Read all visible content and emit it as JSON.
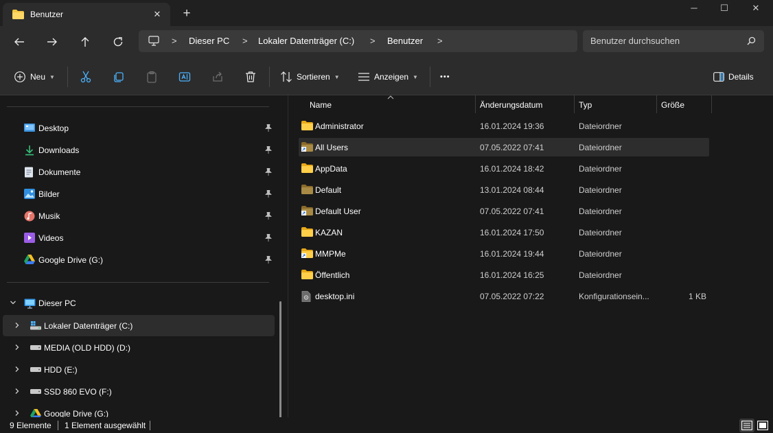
{
  "window": {
    "tab_title": "Benutzer",
    "tab_icon": "folder-icon",
    "close_tab_symbol": "✕",
    "new_tab_symbol": "+",
    "controls": {
      "minimize": "─",
      "maximize": "☐",
      "close": "✕"
    }
  },
  "nav": {
    "back": "arrow-left-icon",
    "forward": "arrow-right-icon",
    "up": "arrow-up-icon",
    "refresh": "refresh-icon"
  },
  "address": {
    "separator": ">",
    "crumbs": [
      "Dieser PC",
      "Lokaler Datenträger (C:)",
      "Benutzer"
    ]
  },
  "search": {
    "placeholder": "Benutzer durchsuchen"
  },
  "toolbar": {
    "new_label": "Neu",
    "sort_label": "Sortieren",
    "view_label": "Anzeigen",
    "more_label": "•••",
    "details_label": "Details"
  },
  "sidebar": {
    "quick_access": [
      {
        "label": "Desktop",
        "icon": "desktop-icon"
      },
      {
        "label": "Downloads",
        "icon": "download-icon"
      },
      {
        "label": "Dokumente",
        "icon": "document-icon"
      },
      {
        "label": "Bilder",
        "icon": "pictures-icon"
      },
      {
        "label": "Musik",
        "icon": "music-icon"
      },
      {
        "label": "Videos",
        "icon": "video-icon"
      },
      {
        "label": "Google Drive (G:)",
        "icon": "google-drive-icon"
      }
    ],
    "this_pc_label": "Dieser PC",
    "drives": [
      {
        "label": "Lokaler Datenträger (C:)",
        "selected": true
      },
      {
        "label": "MEDIA (OLD HDD) (D:)",
        "selected": false
      },
      {
        "label": "HDD (E:)",
        "selected": false
      },
      {
        "label": "SSD 860 EVO (F:)",
        "selected": false
      },
      {
        "label": "Google Drive (G:)",
        "selected": false
      }
    ]
  },
  "columns": {
    "name": "Name",
    "date": "Änderungsdatum",
    "type": "Typ",
    "size": "Größe"
  },
  "files": [
    {
      "name": "Administrator",
      "date": "16.01.2024 19:36",
      "type": "Dateiordner",
      "size": "",
      "icon": "folder-icon",
      "selected": false
    },
    {
      "name": "All Users",
      "date": "07.05.2022 07:41",
      "type": "Dateiordner",
      "size": "",
      "icon": "folder-link-icon",
      "selected": true
    },
    {
      "name": "AppData",
      "date": "16.01.2024 18:42",
      "type": "Dateiordner",
      "size": "",
      "icon": "folder-icon",
      "selected": false
    },
    {
      "name": "Default",
      "date": "13.01.2024 08:44",
      "type": "Dateiordner",
      "size": "",
      "icon": "folder-hidden-icon",
      "selected": false
    },
    {
      "name": "Default User",
      "date": "07.05.2022 07:41",
      "type": "Dateiordner",
      "size": "",
      "icon": "folder-link-icon",
      "selected": false
    },
    {
      "name": "KAZAN",
      "date": "16.01.2024 17:50",
      "type": "Dateiordner",
      "size": "",
      "icon": "folder-icon",
      "selected": false
    },
    {
      "name": "MMPMe",
      "date": "16.01.2024 19:44",
      "type": "Dateiordner",
      "size": "",
      "icon": "folder-link-icon",
      "selected": false
    },
    {
      "name": "Öffentlich",
      "date": "16.01.2024 16:25",
      "type": "Dateiordner",
      "size": "",
      "icon": "folder-icon",
      "selected": false
    },
    {
      "name": "desktop.ini",
      "date": "07.05.2022 07:22",
      "type": "Konfigurationsein...",
      "size": "1 KB",
      "icon": "ini-file-icon",
      "selected": false
    }
  ],
  "status": {
    "count": "9 Elemente",
    "selection": "1 Element ausgewählt"
  },
  "colors": {
    "background": "#191919",
    "toolbar": "#2c2c2c",
    "folder": "#f4c542",
    "accent": "#60cdff"
  }
}
